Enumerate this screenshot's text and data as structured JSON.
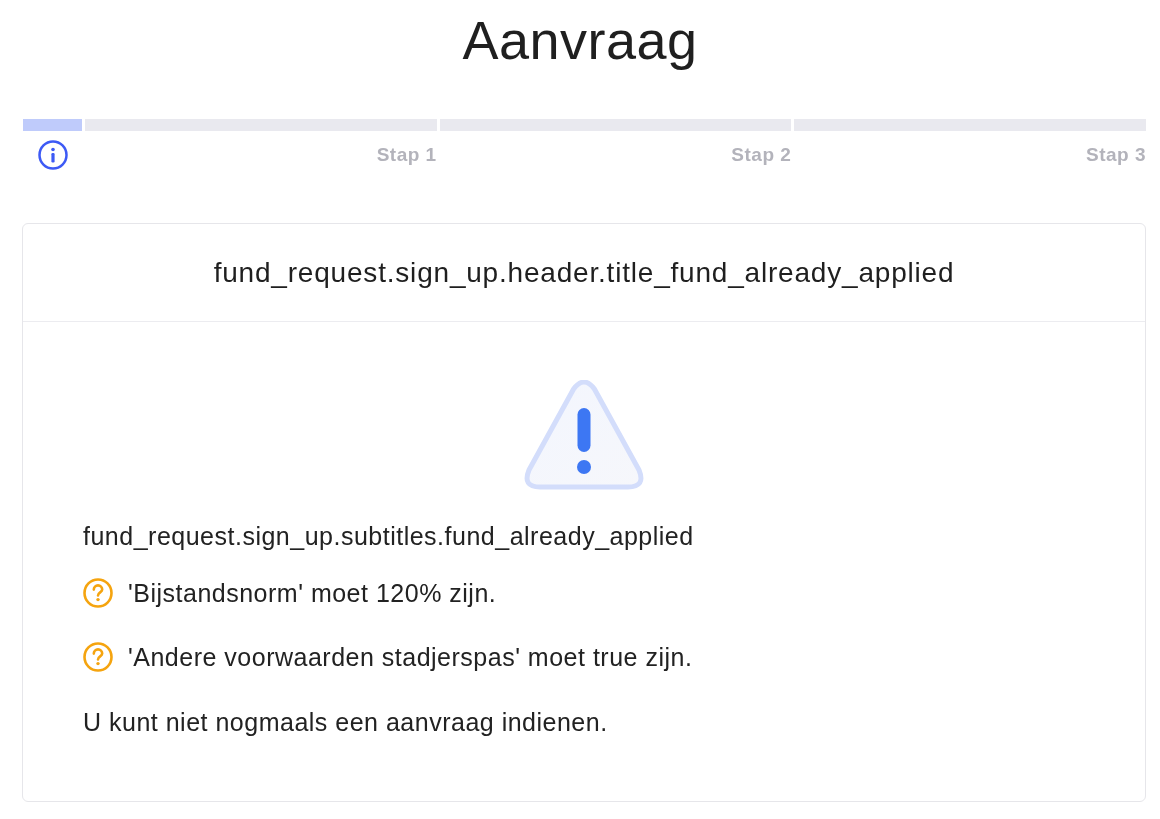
{
  "page": {
    "title": "Aanvraag"
  },
  "steps": [
    {
      "kind": "info",
      "selected": true
    },
    {
      "kind": "step",
      "label": "Stap 1",
      "selected": false
    },
    {
      "kind": "step",
      "label": "Stap 2",
      "selected": false
    },
    {
      "kind": "step",
      "label": "Stap 3",
      "selected": false
    }
  ],
  "card": {
    "title": "fund_request.sign_up.header.title_fund_already_applied",
    "subtitle": "fund_request.sign_up.subtitles.fund_already_applied",
    "requirements": [
      "'Bijstandsnorm' moet 120% zijn.",
      "'Andere voorwaarden stadjerspas' moet true zijn."
    ],
    "note": "U kunt niet nogmaals een aanvraag indienen."
  }
}
